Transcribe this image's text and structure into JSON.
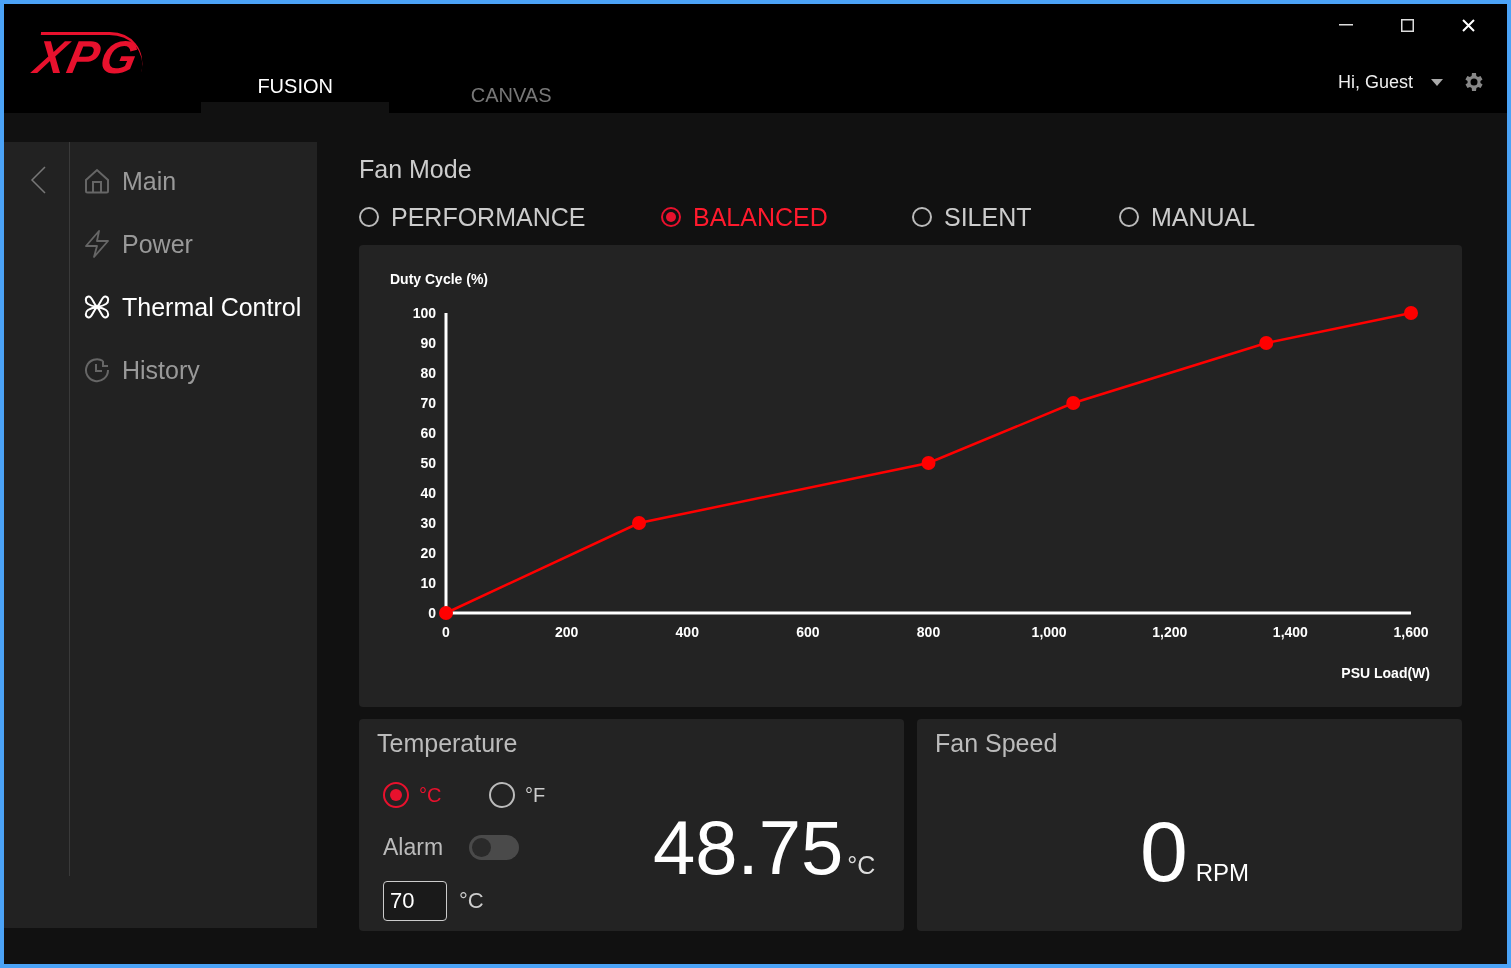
{
  "logo": "XPG",
  "tabs": [
    {
      "label": "FUSION",
      "selected": true
    },
    {
      "label": "CANVAS",
      "selected": false
    }
  ],
  "user": {
    "greeting": "Hi, Guest"
  },
  "sidebar": {
    "items": [
      {
        "label": "Main",
        "selected": false
      },
      {
        "label": "Power",
        "selected": false
      },
      {
        "label": "Thermal Control",
        "selected": true
      },
      {
        "label": "History",
        "selected": false
      }
    ]
  },
  "fan_mode": {
    "title": "Fan Mode",
    "options": [
      {
        "label": "PERFORMANCE",
        "selected": false
      },
      {
        "label": "BALANCED",
        "selected": true
      },
      {
        "label": "SILENT",
        "selected": false
      },
      {
        "label": "MANUAL",
        "selected": false
      }
    ]
  },
  "chart": {
    "chart_data": {
      "type": "line",
      "ylabel": "Duty Cycle (%)",
      "xlabel": "PSU Load(W)",
      "x": [
        0,
        320,
        800,
        1040,
        1360,
        1600
      ],
      "series": [
        {
          "color": "#ff0000",
          "marker": "circle",
          "values": [
            0,
            30,
            50,
            70,
            90,
            100
          ]
        }
      ],
      "xlim": [
        0,
        1600
      ],
      "ylim": [
        0,
        100
      ],
      "xticks": [
        0,
        200,
        400,
        600,
        800,
        {
          "value": 1000,
          "label": "1,000"
        },
        {
          "value": 1200,
          "label": "1,200"
        },
        {
          "value": 1400,
          "label": "1,400"
        },
        {
          "value": 1600,
          "label": "1,600"
        }
      ],
      "yticks": [
        0,
        10,
        20,
        30,
        40,
        50,
        60,
        70,
        80,
        90,
        100
      ]
    }
  },
  "temperature": {
    "title": "Temperature",
    "units": [
      {
        "label": "°C",
        "selected": true
      },
      {
        "label": "°F",
        "selected": false
      }
    ],
    "alarm": {
      "label": "Alarm",
      "on": false
    },
    "threshold": {
      "value": "70",
      "unit": "°C"
    },
    "reading": "48.75",
    "reading_unit": "°C"
  },
  "fan_speed": {
    "title": "Fan Speed",
    "reading": "0",
    "unit": "RPM"
  }
}
